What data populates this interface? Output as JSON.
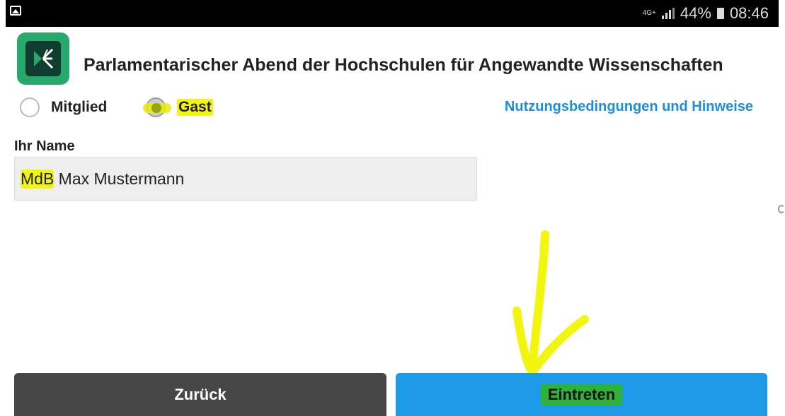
{
  "status_bar": {
    "network": "4G+",
    "battery": "44%",
    "time": "08:46",
    "gallery_icon": "image-icon"
  },
  "app": {
    "icon": "adobe-connect-icon",
    "title": "Parlamentarischer Abend der Hochschulen für Angewandte Wissenschaften"
  },
  "role": {
    "options": [
      {
        "label": "Mitglied",
        "selected": false
      },
      {
        "label": "Gast",
        "selected": true
      }
    ],
    "terms_link": "Nutzungsbedingungen und Hinweise"
  },
  "name_field": {
    "label": "Ihr Name",
    "value_prefix": "MdB",
    "value_rest": " Max Mustermann"
  },
  "buttons": {
    "back": "Zurück",
    "enter": "Eintreten"
  },
  "colors": {
    "accent_blue": "#1e9be8",
    "link_blue": "#1b8fd8",
    "back_button": "#474747",
    "highlight_yellow": "#f2f50d",
    "icon_green": "#29a86d"
  }
}
